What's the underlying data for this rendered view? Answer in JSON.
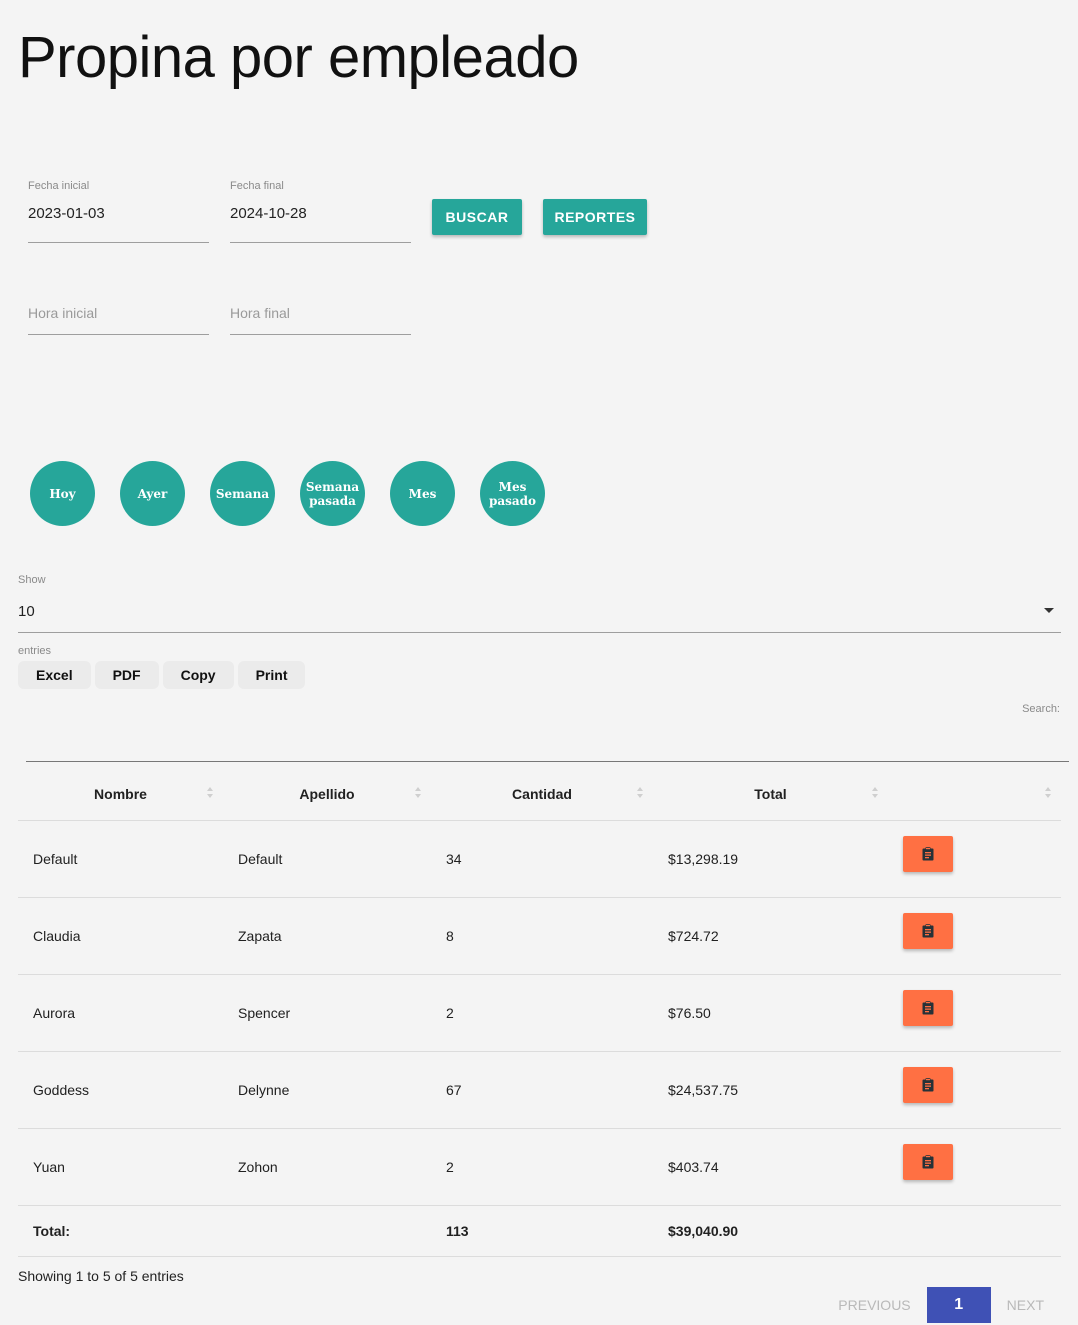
{
  "title": "Propina por empleado",
  "filters": {
    "start_date": {
      "label": "Fecha inicial",
      "value": "2023-01-03"
    },
    "end_date": {
      "label": "Fecha final",
      "value": "2024-10-28"
    },
    "start_time": {
      "placeholder": "Hora inicial"
    },
    "end_time": {
      "placeholder": "Hora final"
    },
    "search_button": "BUSCAR",
    "reports_button": "REPORTES"
  },
  "quick_ranges": [
    "Hoy",
    "Ayer",
    "Semana",
    "Semana pasada",
    "Mes",
    "Mes pasado"
  ],
  "length": {
    "show_label": "Show",
    "value": "10",
    "entries_label": "entries"
  },
  "export_buttons": [
    "Excel",
    "PDF",
    "Copy",
    "Print"
  ],
  "search": {
    "label": "Search:"
  },
  "table": {
    "headers": [
      "Nombre",
      "Apellido",
      "Cantidad",
      "Total",
      ""
    ],
    "rows": [
      {
        "nombre": "Default",
        "apellido": "Default",
        "cantidad": "34",
        "total": "$13,298.19"
      },
      {
        "nombre": "Claudia",
        "apellido": "Zapata",
        "cantidad": "8",
        "total": "$724.72"
      },
      {
        "nombre": "Aurora",
        "apellido": "Spencer",
        "cantidad": "2",
        "total": "$76.50"
      },
      {
        "nombre": "Goddess",
        "apellido": "Delynne",
        "cantidad": "67",
        "total": "$24,537.75"
      },
      {
        "nombre": "Yuan",
        "apellido": "Zohon",
        "cantidad": "2",
        "total": "$403.74"
      }
    ],
    "footer": {
      "label": "Total:",
      "cantidad": "113",
      "total": "$39,040.90"
    },
    "action_icon": "clipboard-icon"
  },
  "info": "Showing 1 to 5 of 5 entries",
  "pagination": {
    "previous": "PREVIOUS",
    "current": "1",
    "next": "NEXT"
  },
  "colors": {
    "teal": "#26a69a",
    "orange": "#ff7043",
    "indigo": "#3f51b5"
  }
}
